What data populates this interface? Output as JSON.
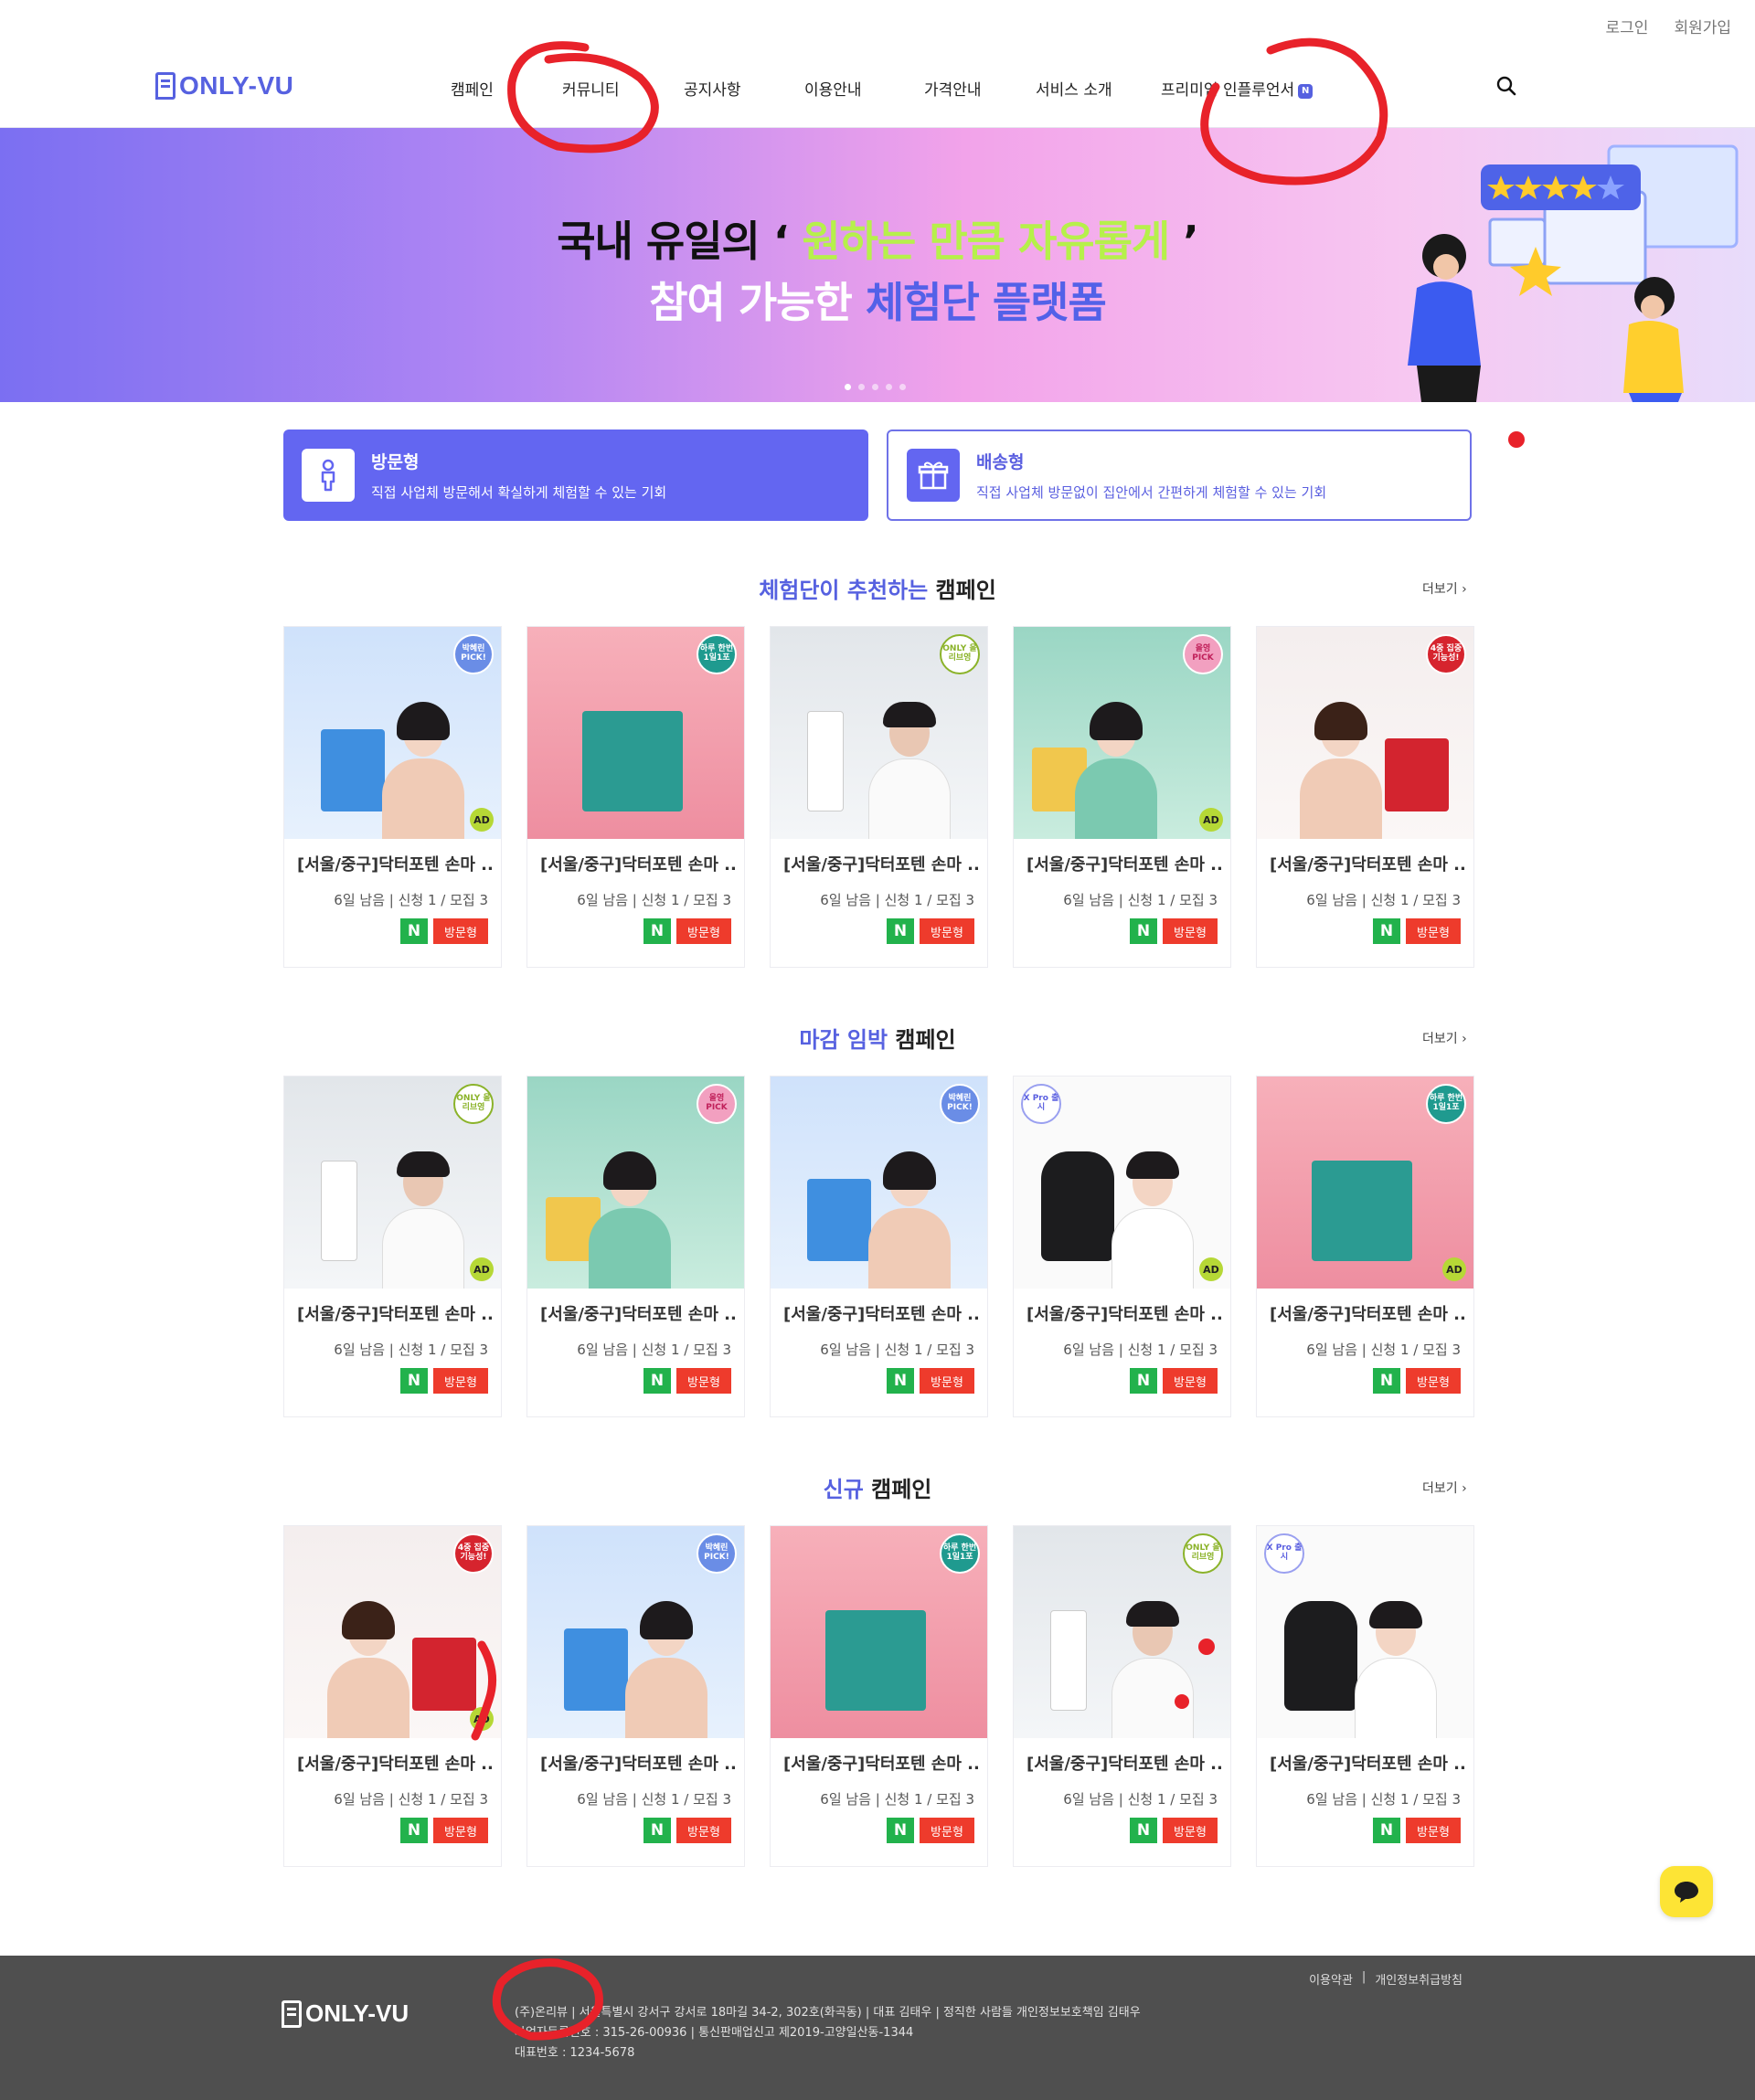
{
  "util_links": {
    "login": "로그인",
    "signup": "회원가입"
  },
  "brand": {
    "name": "ONLY-VU",
    "color": "#5661e0"
  },
  "nav": {
    "items": [
      "캠페인",
      "커뮤니티",
      "공지사항",
      "이용안내",
      "가격안내",
      "서비스 소개",
      "프리미엄 인플루언서"
    ],
    "badge": "N"
  },
  "hero": {
    "line1_pre": "국내 유일의 ‘ ",
    "line1_highlight": "원하는 만큼 자유롭게",
    "line1_post": " ’",
    "line2_pre": "참여 가능한 ",
    "line2_highlight": "체험단 플랫폼",
    "slide_count": 5,
    "active_slide": 1
  },
  "types": {
    "visit": {
      "title": "방문형",
      "desc": "직접 사업체 방문해서 확실하게 체험할 수 있는 기회"
    },
    "ship": {
      "title": "배송형",
      "desc": "직접 사업체 방문없이 집안에서 간편하게 체험할 수 있는 기회"
    }
  },
  "sections": [
    {
      "accent": "체험단이 추천하는",
      "rest": " 캠페인",
      "more": "더보기 ›"
    },
    {
      "accent": "마감 임박",
      "rest": " 캠페인",
      "more": "더보기 ›"
    },
    {
      "accent": "신규",
      "rest": " 캠페인",
      "more": "더보기 ›"
    }
  ],
  "card": {
    "title": "[서울/중구]닥터포텐 손마 ..",
    "meta": "6일 남음 | 신청 1 / 모집 3",
    "tag_n": "N",
    "tag_visit": "방문형",
    "ad": "AD"
  },
  "badges": {
    "billd": "박혜린 PICK!",
    "rulefit": "하루 한번 1일1포",
    "only": "ONLY 올리브영",
    "pick": "올영 PICK",
    "seohyun": "4중 집중 기능성!",
    "xpro": "X Pro 출시"
  },
  "footer": {
    "brand": "ONLY-VU",
    "links": [
      "이용약관",
      "|",
      "개인정보취급방침"
    ],
    "line1": "(주)온리뷰   |   서울특별시 강서구 강서로 18마길 34-2, 302호(화곡동)   |   대표 김태우   |   정직한 사람들 개인정보보호책임 김태우",
    "line2": "사업자등록번호 : 315-26-00936   |   통신판매업신고 제2019-고양일산동-1344",
    "line3": "대표번호 : 1234-5678"
  }
}
